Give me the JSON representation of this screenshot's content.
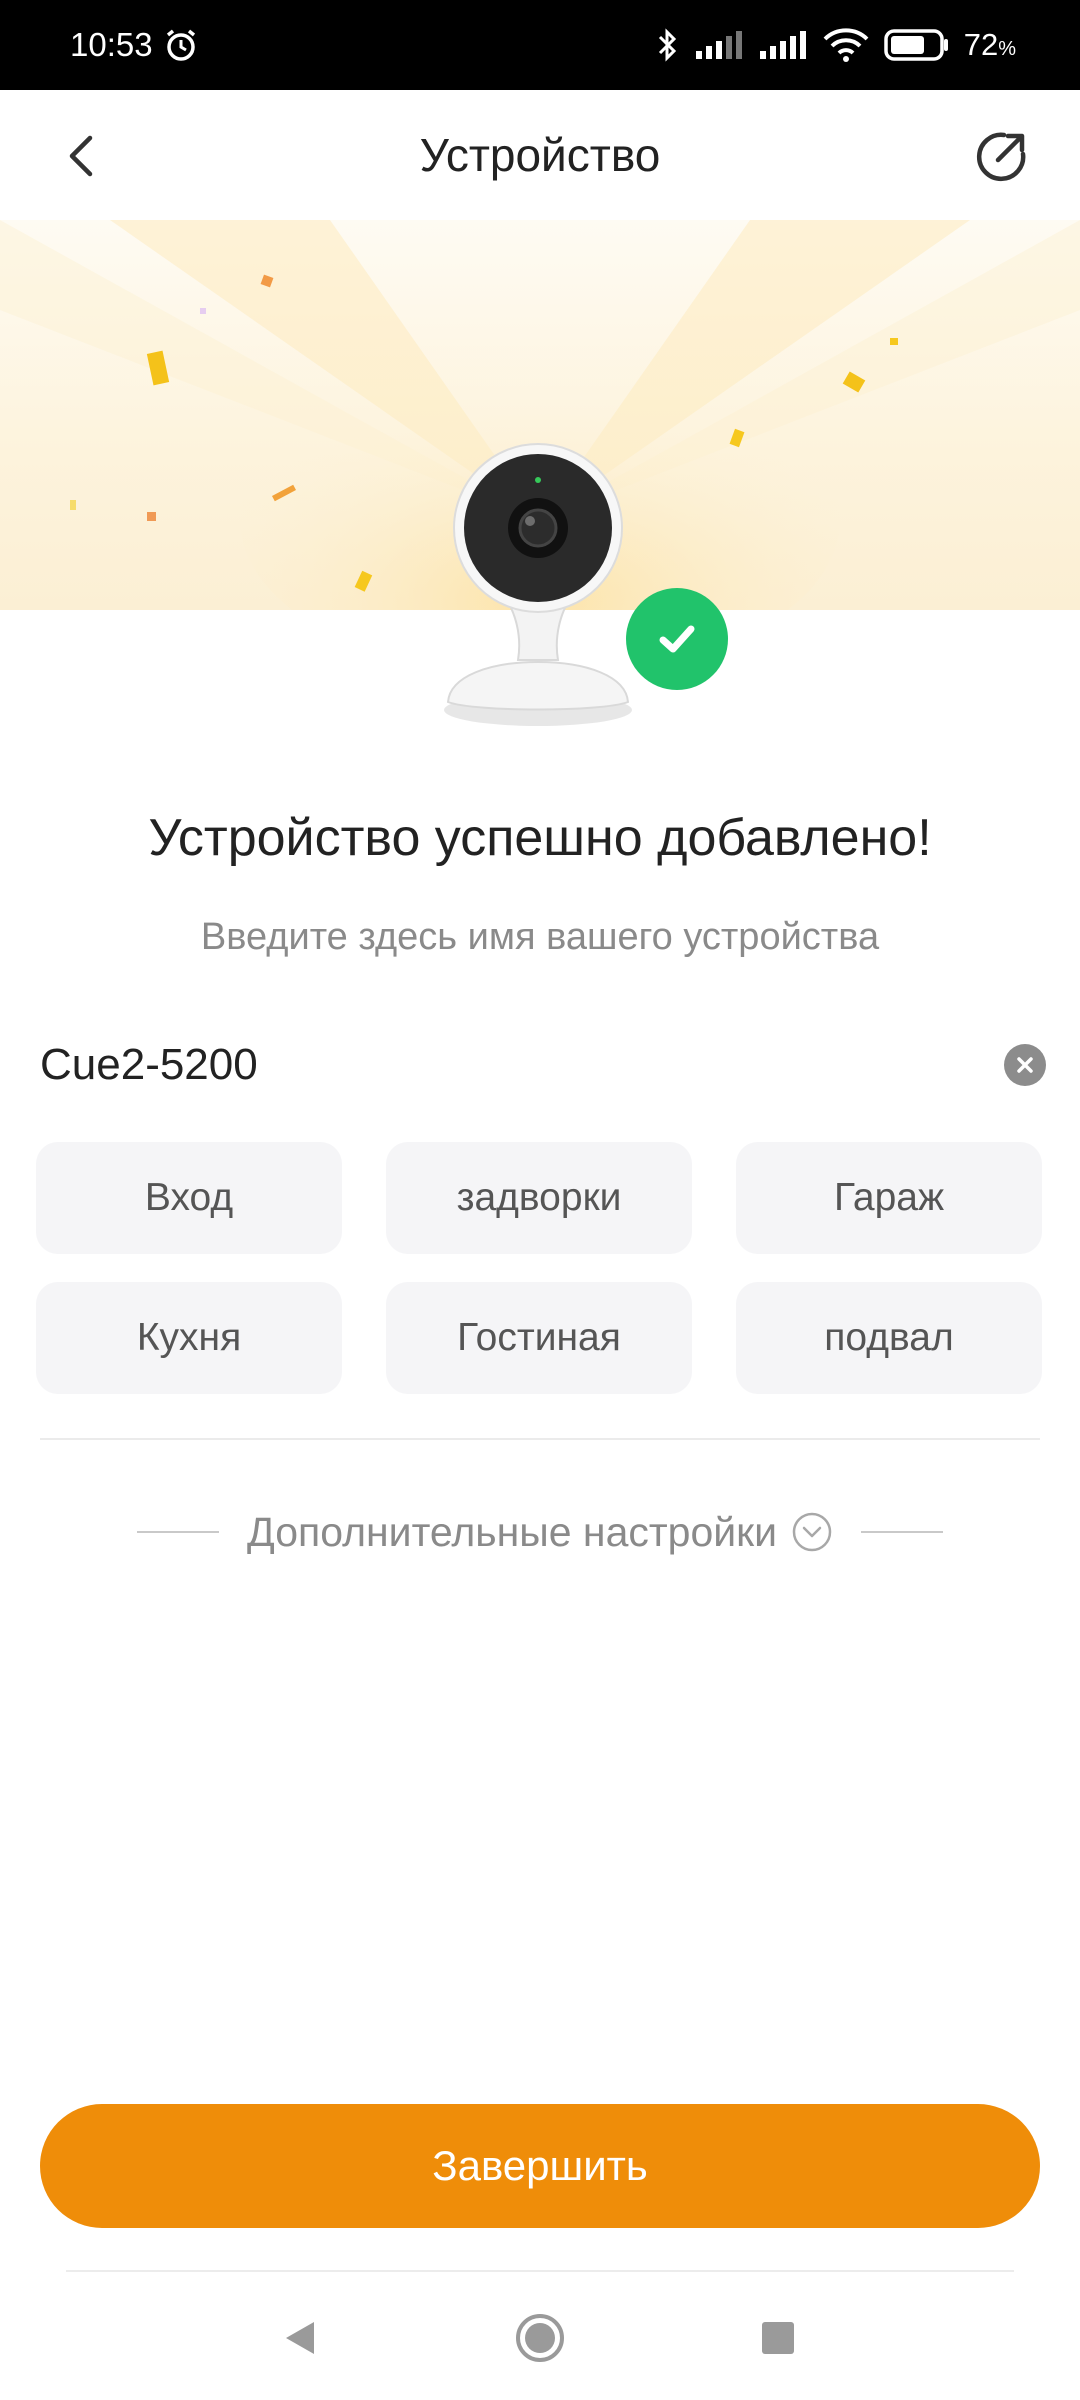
{
  "status_bar": {
    "time": "10:53",
    "battery_percent": "72",
    "battery_unit": "%",
    "battery_level": 0.72
  },
  "header": {
    "title": "Устройство"
  },
  "content": {
    "success_title": "Устройство успешно добавлено!",
    "subtitle": "Введите здесь имя вашего устройства",
    "device_name": "Cue2-5200",
    "chips": [
      "Вход",
      "задворки",
      "Гараж",
      "Кухня",
      "Гостиная",
      "подвал"
    ],
    "advanced_label": "Дополнительные настройки"
  },
  "actions": {
    "finish_label": "Завершить"
  },
  "colors": {
    "accent": "#ef8d09",
    "success": "#21c36b",
    "chip_bg": "#f5f5f7"
  }
}
